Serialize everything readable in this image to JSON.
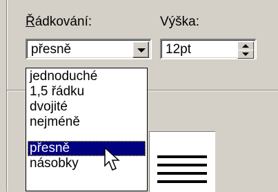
{
  "spacing": {
    "label_prefix": "",
    "label_underlined": "Ř",
    "label_rest": "ádkování:",
    "selected_value": "přesně",
    "options": [
      "jednoduché",
      "1,5 řádku",
      "dvojité",
      "nejméně",
      "přesně",
      "násobky"
    ],
    "selected_index": 4
  },
  "height": {
    "label": "Výška:",
    "value": "12pt"
  },
  "colors": {
    "dialog_bg": "#d4d0c8",
    "selection_bg": "#000080",
    "selection_text": "#ffffff"
  },
  "icons": {
    "dropdown": "chevron-down-icon",
    "spin_up": "spin-up-icon",
    "spin_down": "spin-down-icon",
    "cursor": "mouse-pointer-icon"
  }
}
